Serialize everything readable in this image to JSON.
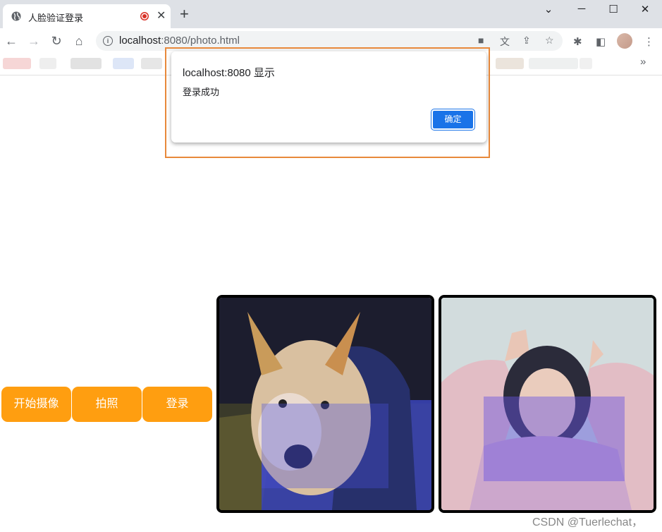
{
  "browser": {
    "tab_title": "人脸验证登录",
    "new_tab": "+",
    "close_tab": "✕",
    "window_controls": {
      "menu": "⌄",
      "minimize": "─",
      "maximize": "☐",
      "close": "✕"
    },
    "url_host": "localhost",
    "url_rest": ":8080/photo.html",
    "bookmarks_more": "»"
  },
  "dialog": {
    "title": "localhost:8080 显示",
    "message": "登录成功",
    "ok_label": "确定"
  },
  "buttons": {
    "start_camera": "开始摄像",
    "take_photo": "拍照",
    "login": "登录"
  },
  "watermark": "CSDN @Tuerlechat，",
  "colors": {
    "button_bg": "#ff9e10",
    "dialog_button": "#1a73e8",
    "highlight_border": "#e8893b"
  }
}
